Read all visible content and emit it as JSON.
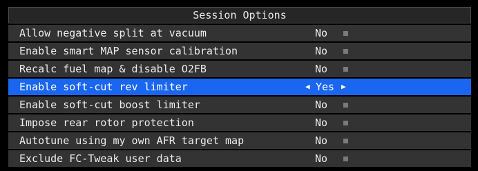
{
  "panel": {
    "title": "Session Options"
  },
  "options": [
    {
      "label": "Allow negative split at vacuum",
      "value": "No",
      "selected": false
    },
    {
      "label": "Enable smart MAP sensor calibration",
      "value": "No",
      "selected": false
    },
    {
      "label": "Recalc fuel map & disable O2FB",
      "value": "No",
      "selected": false
    },
    {
      "label": "Enable soft-cut rev limiter",
      "value": "Yes",
      "selected": true
    },
    {
      "label": "Enable soft-cut boost limiter",
      "value": "No",
      "selected": false
    },
    {
      "label": "Impose rear rotor protection",
      "value": "No",
      "selected": false
    },
    {
      "label": "Autotune using my own AFR target map",
      "value": "No",
      "selected": false
    },
    {
      "label": "Exclude FC-Tweak user data",
      "value": "No",
      "selected": false
    }
  ],
  "icons": {
    "prev": "left-arrow-icon",
    "next": "right-arrow-icon",
    "toggle_marker": "square-marker-icon"
  },
  "colors": {
    "background": "#000000",
    "row": "#333333",
    "header": "#262626",
    "selected": "#1a66f0",
    "text": "#ececec"
  }
}
